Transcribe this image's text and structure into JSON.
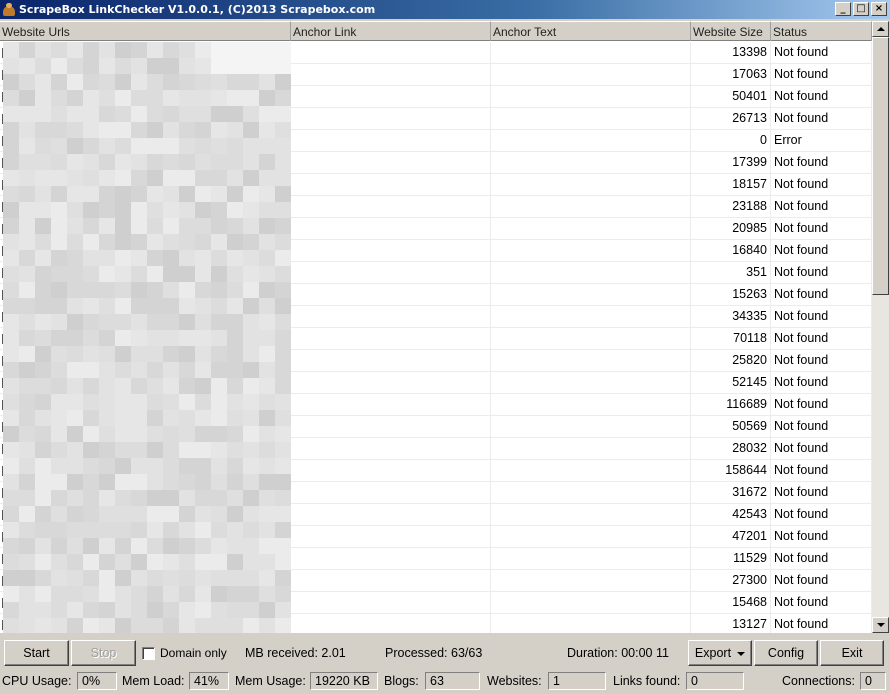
{
  "window": {
    "title": "ScrapeBox LinkChecker V1.0.0.1, (C)2013 Scrapebox.com",
    "minimize": "_",
    "maximize": "□",
    "close": "×"
  },
  "columns": [
    "Website Urls",
    "Anchor Link",
    "Anchor Text",
    "Website Size",
    "Status"
  ],
  "rows": [
    {
      "size": "13398",
      "status": "Not found"
    },
    {
      "size": "17063",
      "status": "Not found"
    },
    {
      "size": "50401",
      "status": "Not found"
    },
    {
      "size": "26713",
      "status": "Not found"
    },
    {
      "size": "0",
      "status": "Error"
    },
    {
      "size": "17399",
      "status": "Not found"
    },
    {
      "size": "18157",
      "status": "Not found"
    },
    {
      "size": "23188",
      "status": "Not found"
    },
    {
      "size": "20985",
      "status": "Not found"
    },
    {
      "size": "16840",
      "status": "Not found"
    },
    {
      "size": "351",
      "status": "Not found"
    },
    {
      "size": "15263",
      "status": "Not found"
    },
    {
      "size": "34335",
      "status": "Not found"
    },
    {
      "size": "70118",
      "status": "Not found"
    },
    {
      "size": "25820",
      "status": "Not found"
    },
    {
      "size": "52145",
      "status": "Not found"
    },
    {
      "size": "116689",
      "status": "Not found"
    },
    {
      "size": "50569",
      "status": "Not found"
    },
    {
      "size": "28032",
      "status": "Not found"
    },
    {
      "size": "158644",
      "status": "Not found"
    },
    {
      "size": "31672",
      "status": "Not found"
    },
    {
      "size": "42543",
      "status": "Not found"
    },
    {
      "size": "47201",
      "status": "Not found"
    },
    {
      "size": "11529",
      "status": "Not found"
    },
    {
      "size": "27300",
      "status": "Not found"
    },
    {
      "size": "15468",
      "status": "Not found"
    },
    {
      "size": "13127",
      "status": "Not found"
    }
  ],
  "toolbar": {
    "start": "Start",
    "stop": "Stop",
    "domain_only": "Domain only",
    "mb_received": "MB received:  2.01",
    "processed": "Processed:  63/63",
    "duration": "Duration:  00:00 11",
    "export": "Export",
    "config": "Config",
    "exit": "Exit"
  },
  "status": {
    "cpu_label": "CPU Usage:",
    "cpu_value": "0%",
    "memload_label": "Mem Load:",
    "memload_value": "41%",
    "memusage_label": "Mem Usage:",
    "memusage_value": "19220 KB",
    "blogs_label": "Blogs:",
    "blogs_value": "63",
    "websites_label": "Websites:",
    "websites_value": "1",
    "links_label": "Links found:",
    "links_value": "0",
    "connections_label": "Connections:",
    "connections_value": "0"
  }
}
